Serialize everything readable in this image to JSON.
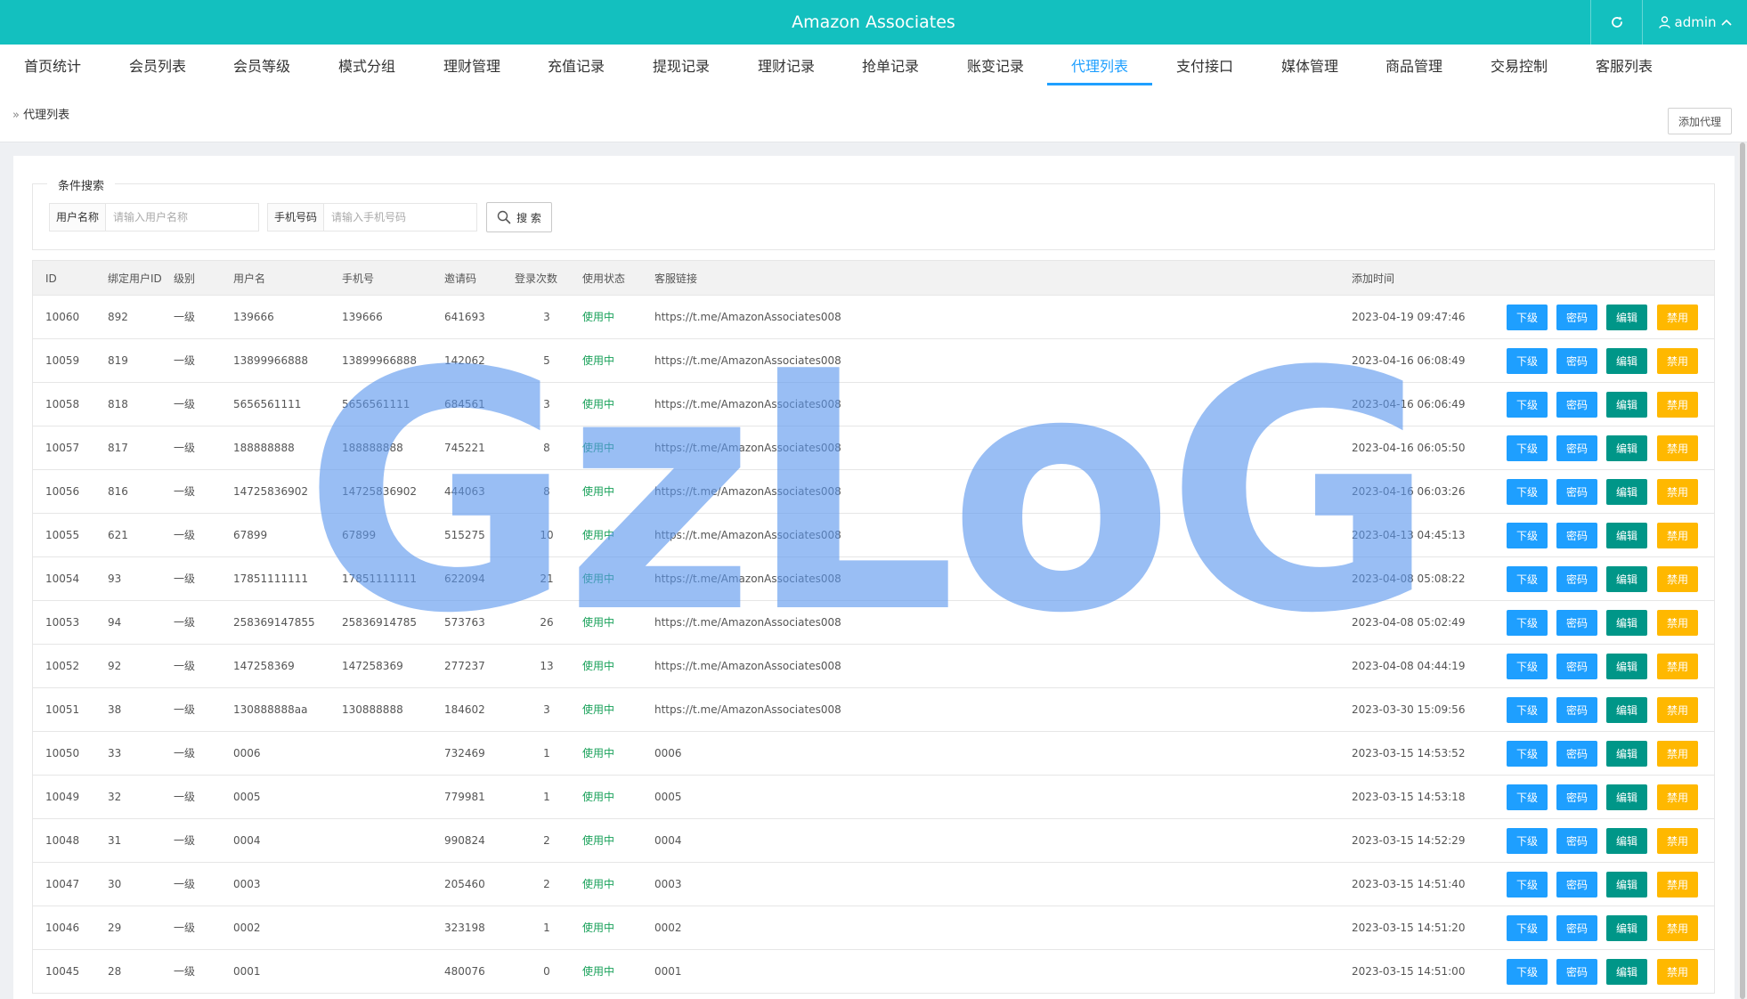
{
  "header": {
    "app_title": "Amazon Associates",
    "user_name": "admin"
  },
  "nav": {
    "active": 10,
    "items": [
      "首页统计",
      "会员列表",
      "会员等级",
      "模式分组",
      "理财管理",
      "充值记录",
      "提现记录",
      "理财记录",
      "抢单记录",
      "账变记录",
      "代理列表",
      "支付接口",
      "媒体管理",
      "商品管理",
      "交易控制",
      "客服列表"
    ]
  },
  "breadcrumb": {
    "label": "代理列表"
  },
  "toolbar": {
    "add_label": "添加代理"
  },
  "search": {
    "legend": "条件搜索",
    "username_label": "用户名称",
    "username_placeholder": "请输入用户名称",
    "phone_label": "手机号码",
    "phone_placeholder": "请输入手机号码",
    "button_label": "搜 索"
  },
  "table": {
    "columns": [
      "ID",
      "绑定用户ID",
      "级别",
      "用户名",
      "手机号",
      "邀请码",
      "登录次数",
      "使用状态",
      "客服链接",
      "添加时间"
    ],
    "actions": [
      "下级",
      "密码",
      "编辑",
      "禁用"
    ],
    "action_colors": [
      "#1e9fff",
      "#1e9fff",
      "#009688",
      "#ffb800"
    ],
    "status_color": "#19a15a",
    "rows": [
      [
        "10060",
        "892",
        "一级",
        "139666",
        "139666",
        "641693",
        "3",
        "使用中",
        "https://t.me/AmazonAssociates008",
        "2023-04-19 09:47:46"
      ],
      [
        "10059",
        "819",
        "一级",
        "13899966888",
        "13899966888",
        "142062",
        "5",
        "使用中",
        "https://t.me/AmazonAssociates008",
        "2023-04-16 06:08:49"
      ],
      [
        "10058",
        "818",
        "一级",
        "5656561111",
        "5656561111",
        "684561",
        "3",
        "使用中",
        "https://t.me/AmazonAssociates008",
        "2023-04-16 06:06:49"
      ],
      [
        "10057",
        "817",
        "一级",
        "188888888",
        "188888888",
        "745221",
        "8",
        "使用中",
        "https://t.me/AmazonAssociates008",
        "2023-04-16 06:05:50"
      ],
      [
        "10056",
        "816",
        "一级",
        "14725836902",
        "14725836902",
        "444063",
        "8",
        "使用中",
        "https://t.me/AmazonAssociates008",
        "2023-04-16 06:03:26"
      ],
      [
        "10055",
        "621",
        "一级",
        "67899",
        "67899",
        "515275",
        "10",
        "使用中",
        "https://t.me/AmazonAssociates008",
        "2023-04-13 04:45:13"
      ],
      [
        "10054",
        "93",
        "一级",
        "17851111111",
        "17851111111",
        "622094",
        "21",
        "使用中",
        "https://t.me/AmazonAssociates008",
        "2023-04-08 05:08:22"
      ],
      [
        "10053",
        "94",
        "一级",
        "258369147855",
        "25836914785",
        "573763",
        "26",
        "使用中",
        "https://t.me/AmazonAssociates008",
        "2023-04-08 05:02:49"
      ],
      [
        "10052",
        "92",
        "一级",
        "147258369",
        "147258369",
        "277237",
        "13",
        "使用中",
        "https://t.me/AmazonAssociates008",
        "2023-04-08 04:44:19"
      ],
      [
        "10051",
        "38",
        "一级",
        "130888888aa",
        "130888888",
        "184602",
        "3",
        "使用中",
        "https://t.me/AmazonAssociates008",
        "2023-03-30 15:09:56"
      ],
      [
        "10050",
        "33",
        "一级",
        "0006",
        "",
        "732469",
        "1",
        "使用中",
        "0006",
        "2023-03-15 14:53:52"
      ],
      [
        "10049",
        "32",
        "一级",
        "0005",
        "",
        "779981",
        "1",
        "使用中",
        "0005",
        "2023-03-15 14:53:18"
      ],
      [
        "10048",
        "31",
        "一级",
        "0004",
        "",
        "990824",
        "2",
        "使用中",
        "0004",
        "2023-03-15 14:52:29"
      ],
      [
        "10047",
        "30",
        "一级",
        "0003",
        "",
        "205460",
        "2",
        "使用中",
        "0003",
        "2023-03-15 14:51:40"
      ],
      [
        "10046",
        "29",
        "一级",
        "0002",
        "",
        "323198",
        "1",
        "使用中",
        "0002",
        "2023-03-15 14:51:20"
      ],
      [
        "10045",
        "28",
        "一级",
        "0001",
        "",
        "480076",
        "0",
        "使用中",
        "0001",
        "2023-03-15 14:51:00"
      ]
    ]
  },
  "watermark": {
    "text": "GzLoG"
  }
}
